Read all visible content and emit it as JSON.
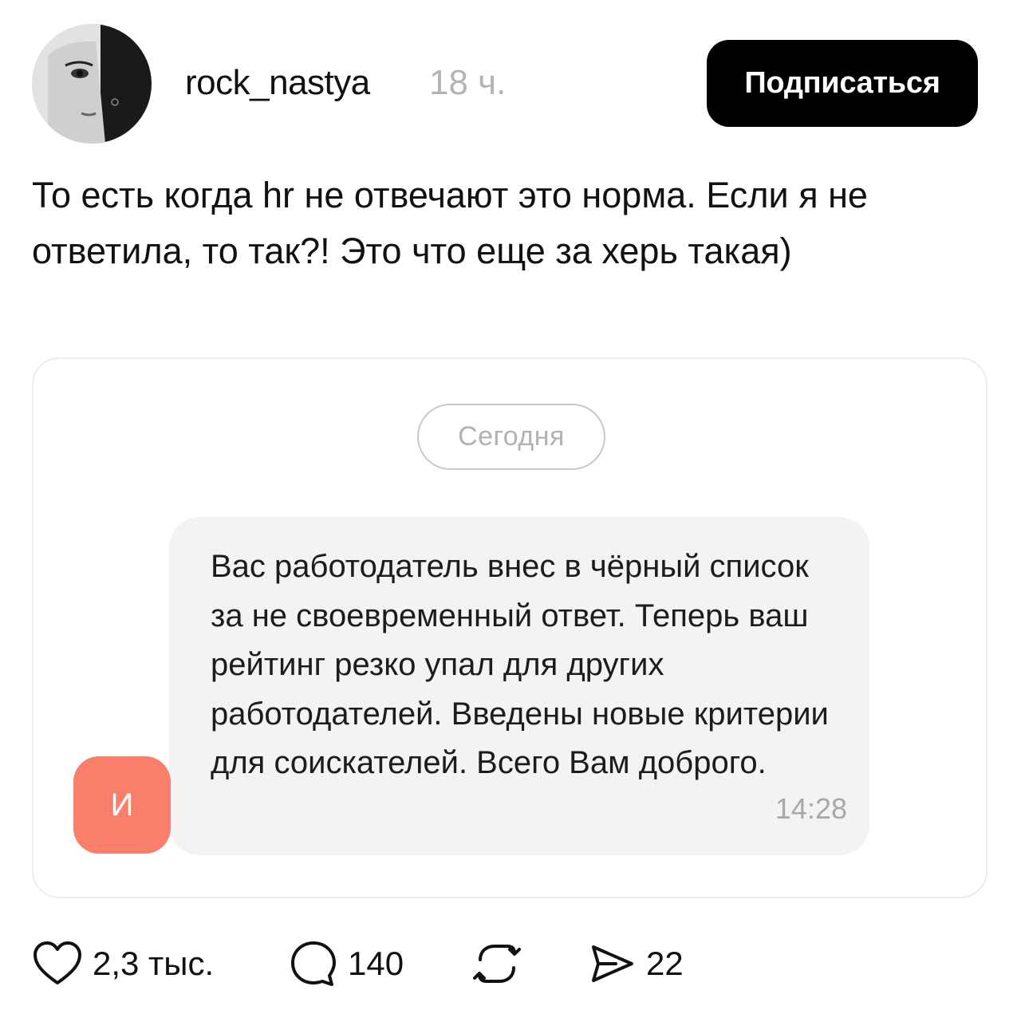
{
  "post": {
    "author": "rock_nastya",
    "time": "18 ч.",
    "follow_label": "Подписаться",
    "text": "То есть когда hr не отвечают это норма. Если я не ответила, то так?! Это что еще за херь такая)"
  },
  "chat": {
    "date_label": "Сегодня",
    "message": "Вас работодатель внес в чёрный список за не своевременный ответ. Теперь ваш рейтинг резко упал для других работодателей. Введены новые критерии для соискателей. Всего Вам доброго.",
    "message_time": "14:28",
    "sender_initial": "И",
    "sender_color": "#f97f6b"
  },
  "actions": {
    "likes": "2,3 тыс.",
    "comments": "140",
    "shares": "22"
  },
  "icons": {
    "like": "heart-icon",
    "comment": "comment-icon",
    "repost": "repost-icon",
    "share": "send-icon"
  }
}
